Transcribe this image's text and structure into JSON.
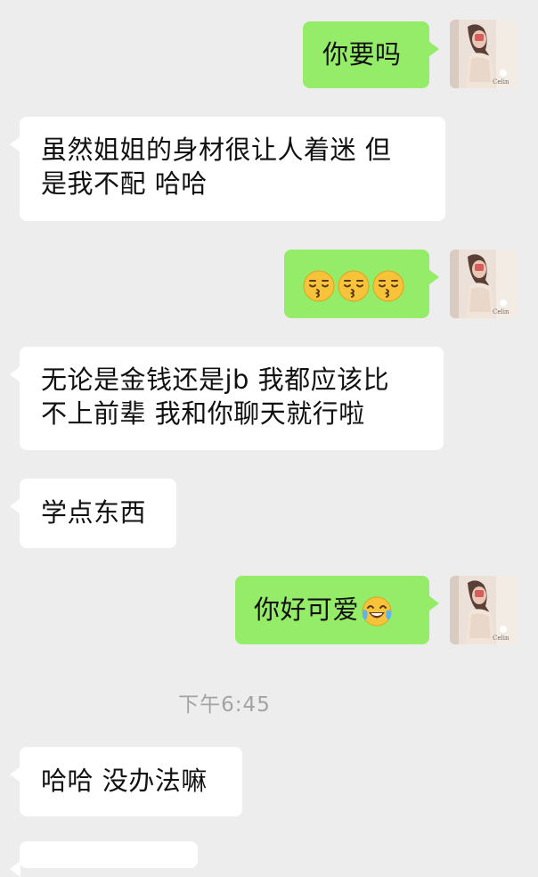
{
  "messages": [
    {
      "side": "me",
      "text": "你要吗"
    },
    {
      "side": "other",
      "line1": "虽然姐姐的身材很让人着迷 但",
      "line2": "是我不配 哈哈"
    },
    {
      "side": "me",
      "emojis": [
        "kissing-closed-eyes-emoji",
        "kissing-closed-eyes-emoji",
        "kissing-closed-eyes-emoji"
      ]
    },
    {
      "side": "other",
      "line1": "无论是金钱还是jb 我都应该比",
      "line2": "不上前辈 我和你聊天就行啦"
    },
    {
      "side": "other",
      "text": "学点东西"
    },
    {
      "side": "me",
      "text": "你好可爱",
      "emoji": "tears-of-joy-emoji"
    },
    {
      "side": "other",
      "text": "哈哈 没办法嘛"
    }
  ],
  "time_divider": "下午6:45",
  "colors": {
    "background": "#ededed",
    "my_bubble": "#95ec69",
    "other_bubble": "#ffffff",
    "time_text": "#a3a3a3"
  }
}
